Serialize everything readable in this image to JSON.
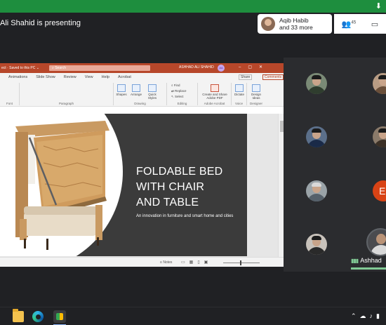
{
  "meet": {
    "presenting_text": "Ali Shahid is presenting",
    "chip_line1": "Aqib Habib",
    "chip_line2": "and 33 more",
    "participant_count": "45",
    "self_name": "Ashhad"
  },
  "ppt": {
    "title_prefix": "ect · Saved to this PC ⌄",
    "search_placeholder": "Search",
    "user_name": "ASHHAD ALI SHAHID",
    "user_initials": "AA",
    "tabs": [
      "Animations",
      "Slide Show",
      "Review",
      "View",
      "Help",
      "Acrobat"
    ],
    "share_label": "Share",
    "comments_label": "Comments",
    "ribbon_groups": {
      "font": "Font",
      "paragraph": "Paragraph",
      "drawing": "Drawing",
      "editing": "Editing",
      "adobe": "Adobe Acrobat",
      "voice": "Voice",
      "designer": "Designer"
    },
    "ribbon_buttons": {
      "shapes": "Shapes",
      "arrange": "Arrange",
      "quick_styles": "Quick Styles",
      "find": "Find",
      "replace": "Replace",
      "select": "Select",
      "create_share": "Create and Share Adobe PDF",
      "dictate": "Dictate",
      "design_ideas": "Design Ideas"
    },
    "slide": {
      "title_line1": "FOLDABLE BED",
      "title_line2": "WITH CHAIR",
      "title_line3": "AND TABLE",
      "subtitle": "An innovation in furniture and smart home and cities"
    },
    "status": {
      "notes": "Notes",
      "zoom": ""
    }
  },
  "colors": {
    "ppt_accent": "#b7472a",
    "meet_green": "#1e8e3e",
    "self_tile_accent": "#81c995",
    "e_avatar": "#d84315"
  },
  "grid": {
    "letter_avatar": "E"
  }
}
